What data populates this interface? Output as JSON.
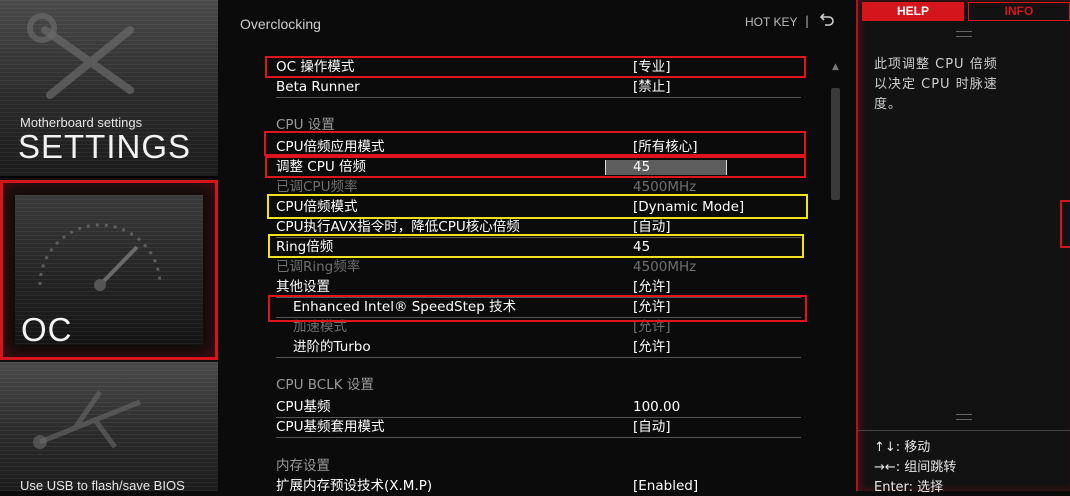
{
  "sidebar": {
    "settings_sub": "Motherboard settings",
    "settings_title": "SETTINGS",
    "oc_title": "OC",
    "usb_text": "Use USB to flash/save BIOS"
  },
  "header": {
    "title": "Overclocking",
    "hotkey": "HOT KEY",
    "separator": "|"
  },
  "rows": [
    {
      "label": "OC 操作模式",
      "value": "[专业]"
    },
    {
      "label": "Beta Runner",
      "value": "[禁止]"
    },
    {
      "label": "CPU  设置",
      "value": ""
    },
    {
      "label": "CPU倍频应用模式",
      "value": "[所有核心]"
    },
    {
      "label": "调整 CPU 倍频",
      "value": "45"
    },
    {
      "label": "已调CPU频率",
      "value": "4500MHz"
    },
    {
      "label": "CPU倍频模式",
      "value": "[Dynamic Mode]"
    },
    {
      "label": "CPU执行AVX指令时，降低CPU核心倍频",
      "value": "[自动]"
    },
    {
      "label": "Ring倍频",
      "value": "45"
    },
    {
      "label": "已调Ring频率",
      "value": "4500MHz"
    },
    {
      "label": "其他设置",
      "value": "[允许]"
    },
    {
      "label": "Enhanced Intel® SpeedStep 技术",
      "value": "[允许]"
    },
    {
      "label": "加速模式",
      "value": "[允许]"
    },
    {
      "label": "进阶的Turbo",
      "value": "[允许]"
    },
    {
      "label": "CPU  BCLK  设置",
      "value": ""
    },
    {
      "label": "CPU基频",
      "value": "100.00"
    },
    {
      "label": "CPU基频套用模式",
      "value": "[自动]"
    },
    {
      "label": "内存设置",
      "value": ""
    },
    {
      "label": "扩展内存预设技术(X.M.P)",
      "value": "[Enabled]"
    }
  ],
  "help": {
    "tab_help": "HELP",
    "tab_info": "INFO",
    "text": "此项调整 CPU 倍频以决定 CPU 时脉速度。",
    "keys": [
      "↑↓: 移动",
      "→←: 组间跳转",
      "Enter: 选择"
    ]
  },
  "colors": {
    "accent": "#d4161c",
    "highlight_red": "#e0141c",
    "highlight_yellow": "#f2e21b",
    "dim_text": "#6f6f6f"
  }
}
